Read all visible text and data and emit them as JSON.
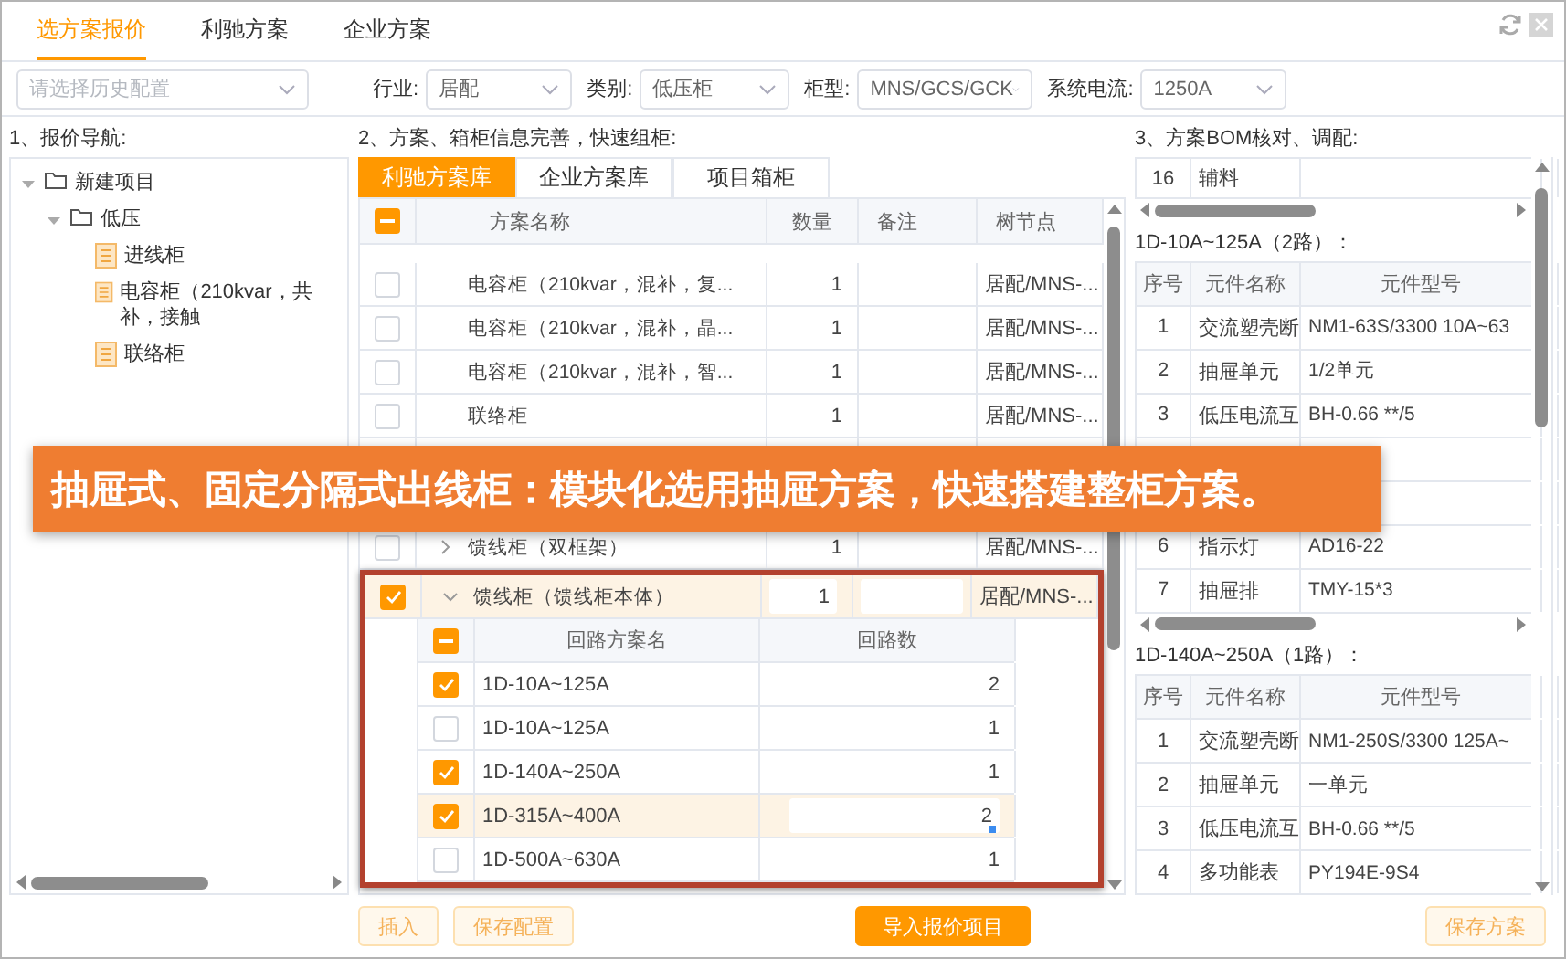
{
  "top_tabs": [
    {
      "label": "选方案报价",
      "selected": true
    },
    {
      "label": "利驰方案",
      "selected": false
    },
    {
      "label": "企业方案",
      "selected": false
    }
  ],
  "history": {
    "placeholder": "请选择历史配置"
  },
  "filters": [
    {
      "label": "行业:",
      "value": "居配"
    },
    {
      "label": "类别:",
      "value": "低压柜"
    },
    {
      "label": "柜型:",
      "value": "MNS/GCS/GCK"
    },
    {
      "label": "系统电流:",
      "value": "1250A"
    }
  ],
  "navigation": {
    "heading": "1、报价导航:",
    "tree": [
      {
        "label": "新建项目",
        "kind": "folder",
        "expanded": true,
        "children": [
          {
            "label": "低压",
            "kind": "folder",
            "expanded": true,
            "children": [
              {
                "label": "进线柜",
                "kind": "cabinet"
              },
              {
                "label": "电容柜（210kvar，共补，接触",
                "kind": "cabinet"
              },
              {
                "label": "联络柜",
                "kind": "cabinet"
              }
            ]
          }
        ]
      }
    ]
  },
  "schemes": {
    "heading": "2、方案、箱柜信息完善，快速组柜:",
    "tabs": [
      {
        "label": "利驰方案库",
        "selected": true
      },
      {
        "label": "企业方案库",
        "selected": false
      },
      {
        "label": "项目箱柜",
        "selected": false
      }
    ],
    "select_all_indeterminate": true,
    "columns": [
      "方案名称",
      "数量",
      "备注",
      "树节点"
    ],
    "rows": [
      {
        "kind": "scheme",
        "checked": false,
        "selected": false,
        "name": "电容柜（210kvar，混补，复...",
        "quantity": "1",
        "node": "居配/MNS-..."
      },
      {
        "kind": "scheme",
        "checked": false,
        "selected": false,
        "name": "电容柜（210kvar，混补，晶...",
        "quantity": "1",
        "node": "居配/MNS-..."
      },
      {
        "kind": "scheme",
        "checked": false,
        "selected": false,
        "name": "电容柜（210kvar，混补，智...",
        "quantity": "1",
        "node": "居配/MNS-..."
      },
      {
        "kind": "scheme",
        "checked": false,
        "selected": false,
        "name": "联络柜",
        "quantity": "1",
        "node": "居配/MNS-..."
      },
      {
        "kind": "covered"
      },
      {
        "kind": "covered"
      },
      {
        "kind": "scheme",
        "checked": false,
        "selected": false,
        "expanded": false,
        "name": "馈线柜（双框架）",
        "quantity": "1",
        "node": "居配/MNS-..."
      },
      {
        "kind": "scheme",
        "checked": true,
        "selected": true,
        "expanded": true,
        "name": "馈线柜（馈线柜本体）",
        "quantity": "1",
        "node": "居配/MNS-...",
        "circuits": {
          "select_all_indeterminate": true,
          "columns": [
            "回路方案名",
            "回路数"
          ],
          "rows": [
            {
              "name": "1D-10A~125A",
              "count": "2",
              "checked": true,
              "selected": false
            },
            {
              "name": "1D-10A~125A",
              "count": "1",
              "checked": false,
              "selected": false
            },
            {
              "name": "1D-140A~250A",
              "count": "1",
              "checked": true,
              "selected": false
            },
            {
              "name": "1D-315A~400A",
              "count": "2",
              "checked": true,
              "selected": true
            },
            {
              "name": "1D-500A~630A",
              "count": "1",
              "checked": false,
              "selected": false
            }
          ]
        }
      }
    ],
    "actions": [
      {
        "label": "插入",
        "kind": "outline"
      },
      {
        "label": "保存配置",
        "kind": "outline"
      },
      {
        "label": "导入报价项目",
        "kind": "primary"
      }
    ]
  },
  "bom": {
    "heading": "3、方案BOM核对、调配:",
    "top_row": {
      "no": "16",
      "name": "辅料"
    },
    "groups": [
      {
        "title": "1D-10A~125A（2路）：",
        "columns": [
          "序号",
          "元件名称",
          "元件型号"
        ],
        "rows": [
          {
            "kind": "part",
            "no": "1",
            "name": "交流塑壳断",
            "model": "NM1-63S/3300 10A~63"
          },
          {
            "kind": "part",
            "no": "2",
            "name": "抽屉单元",
            "model": "1/2单元"
          },
          {
            "kind": "part",
            "no": "3",
            "name": "低压电流互",
            "model": "BH-0.66 **/5"
          },
          {
            "kind": "covered"
          },
          {
            "kind": "covered"
          },
          {
            "kind": "part",
            "no": "6",
            "name": "指示灯",
            "model": "AD16-22"
          },
          {
            "kind": "part",
            "no": "7",
            "name": "抽屉排",
            "model": "TMY-15*3"
          }
        ]
      },
      {
        "title": "1D-140A~250A（1路）：",
        "columns": [
          "序号",
          "元件名称",
          "元件型号"
        ],
        "rows": [
          {
            "kind": "part",
            "no": "1",
            "name": "交流塑壳断",
            "model": "NM1-250S/3300 125A~"
          },
          {
            "kind": "part",
            "no": "2",
            "name": "抽屉单元",
            "model": "一单元"
          },
          {
            "kind": "part",
            "no": "3",
            "name": "低压电流互",
            "model": "BH-0.66 **/5"
          },
          {
            "kind": "part",
            "no": "4",
            "name": "多功能表",
            "model": "PY194E-9S4"
          }
        ]
      }
    ],
    "save_button": {
      "label": "保存方案",
      "kind": "outline"
    }
  },
  "banner": {
    "text": "抽屉式、固定分隔式出线柜：模块化选用抽屉方案，快速搭建整柜方案。"
  }
}
